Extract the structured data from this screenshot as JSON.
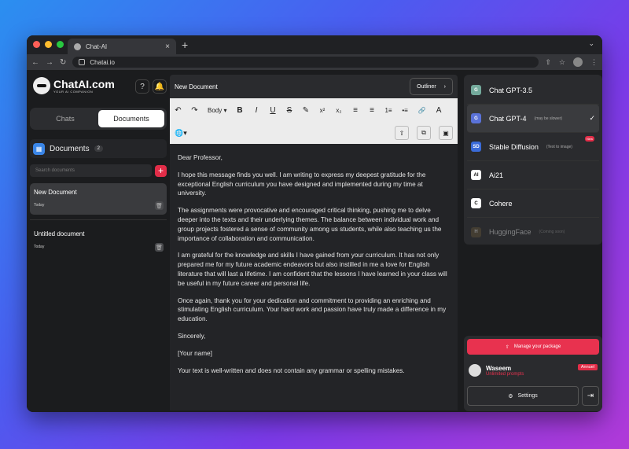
{
  "browser": {
    "tab_title": "Chat-AI",
    "url": "Chatai.io",
    "new_tab": "+",
    "close_tab": "×",
    "menu": "⌄"
  },
  "brand": {
    "name": "ChatAI.com",
    "tagline": "YOUR AI COMPANION"
  },
  "left": {
    "help_icon": "?",
    "bell_icon": "🔔",
    "tabs": [
      "Chats",
      "Documents"
    ],
    "documents_title": "Documents",
    "documents_count": "2",
    "search_placeholder": "Search documents",
    "add": "+",
    "docs": [
      {
        "title": "New Document",
        "date": "Today"
      },
      {
        "title": "Untitled document",
        "date": "Today"
      }
    ]
  },
  "editor": {
    "title": "New Document",
    "outliner": "Outliner",
    "outliner_chev": "›",
    "toolbar": {
      "undo": "↶",
      "redo": "↷",
      "style": "Body ▾",
      "bold": "B",
      "italic": "I",
      "underline": "U",
      "strike": "S",
      "highlight": "✎",
      "sup": "x²",
      "sub": "x₂",
      "align_left": "≡",
      "align_center": "≡",
      "ol": "1≡",
      "ul": "•≡",
      "link": "🔗",
      "clear": "A",
      "lang": "🌐▾",
      "upload": "⇧",
      "copy": "⧉",
      "save": "▣"
    },
    "paragraphs": [
      "Dear Professor,",
      "I hope this message finds you well. I am writing to express my deepest gratitude for the exceptional English curriculum you have designed and implemented during my time at university.",
      "The assignments were provocative and encouraged critical thinking, pushing me to delve deeper into the texts and their underlying themes. The balance between individual work and group projects fostered a sense of community among us students, while also teaching us the importance of collaboration and communication.",
      "I am grateful for the knowledge and skills I have gained from your curriculum. It has not only prepared me for my future academic endeavors but also instilled in me a love for English literature that will last a lifetime. I am confident that the lessons I have learned in your class will be useful in my future career and personal life.",
      "Once again, thank you for your dedication and commitment to providing an enriching and stimulating English curriculum. Your hard work and passion have truly made a difference in my education.",
      "Sincerely,",
      "[Your name]",
      "Your text is well-written and does not contain any grammar or spelling mistakes."
    ]
  },
  "models": [
    {
      "name": "Chat GPT-3.5",
      "note": "",
      "icon": "G",
      "color": "#74aa9c"
    },
    {
      "name": "Chat GPT-4",
      "note": "(may be slower)",
      "icon": "G",
      "color": "#5a72d8",
      "selected": true
    },
    {
      "name": "Stable Diffusion",
      "note": "(Text to image)",
      "icon": "SD",
      "color": "#3a6bd8",
      "badge": "New"
    },
    {
      "name": "Ai21",
      "note": "",
      "icon": "AI",
      "color": "#ffffff"
    },
    {
      "name": "Cohere",
      "note": "",
      "icon": "C",
      "color": "#ffffff"
    },
    {
      "name": "HuggingFace",
      "note": "(Coming soon)",
      "icon": "H",
      "color": "#6a5a3a",
      "dim": true
    }
  ],
  "account": {
    "manage": "Manage your package",
    "name": "Waseem",
    "plan": "Unlimited prompts",
    "badge": "Annuel",
    "settings": "Settings",
    "check": "✓",
    "settings_icon": "⚙",
    "logout": "⇥",
    "manage_icon": "⇧"
  }
}
